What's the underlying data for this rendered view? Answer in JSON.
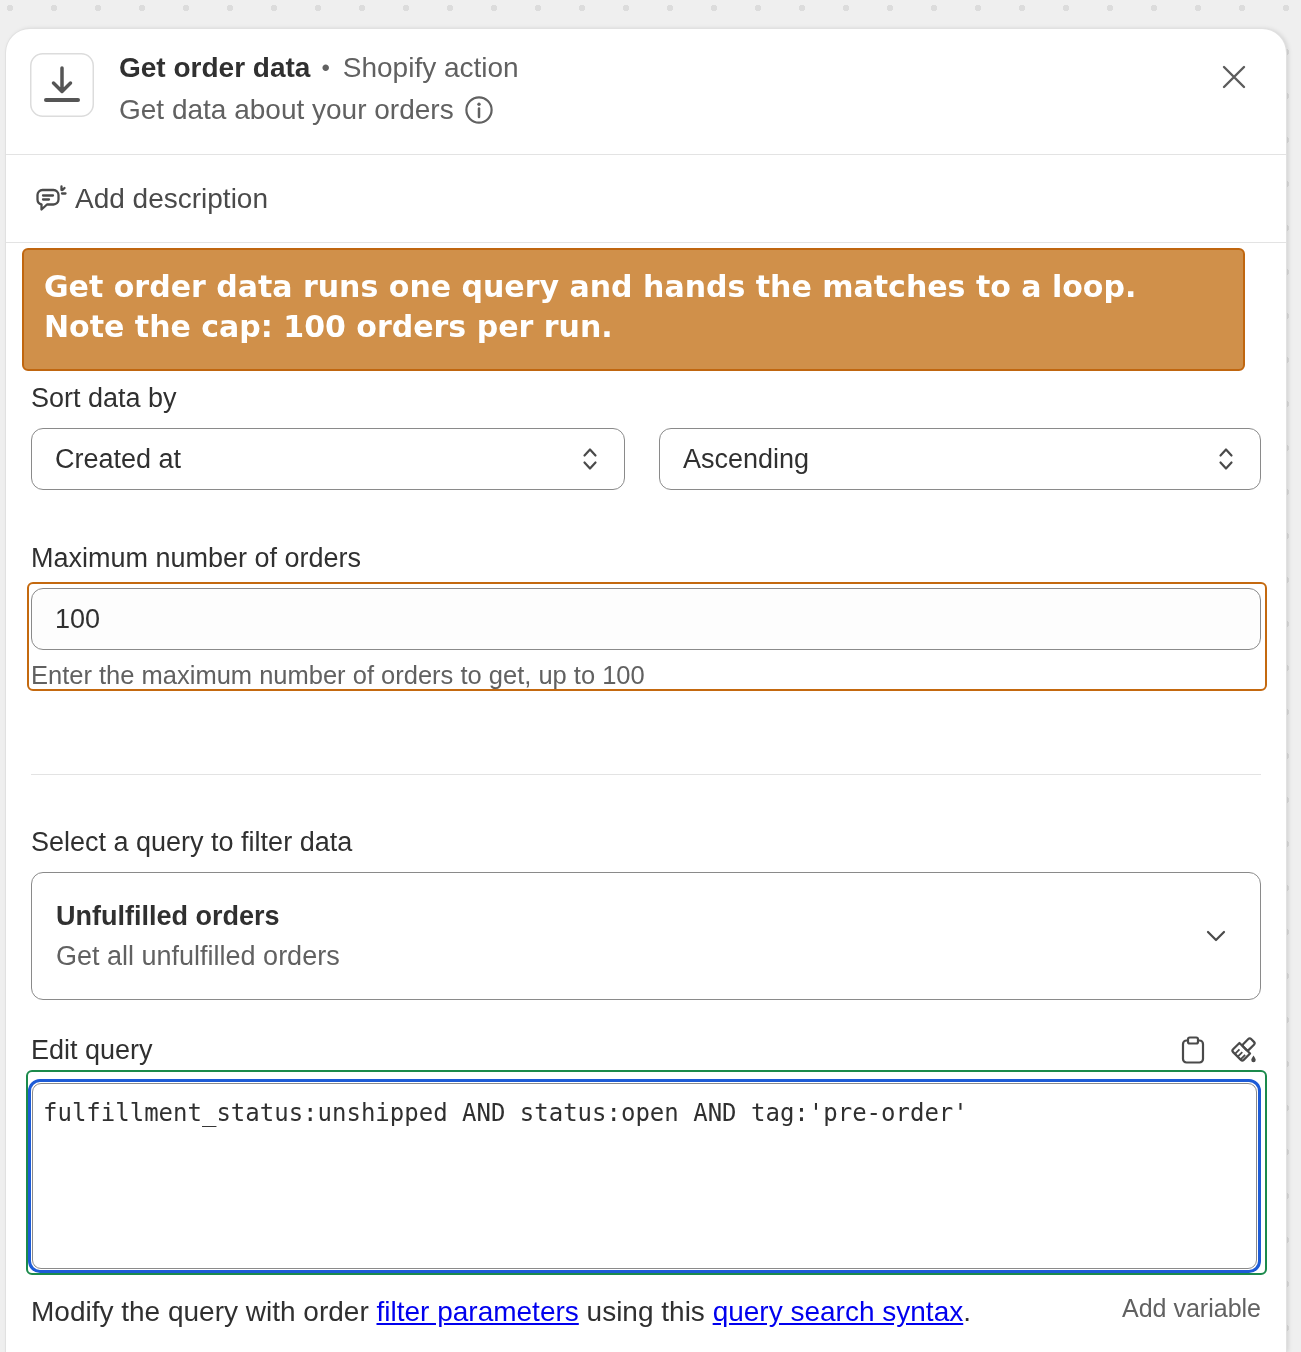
{
  "header": {
    "title": "Get order data",
    "separator": "•",
    "subtitle": "Shopify action",
    "description": "Get data about your orders"
  },
  "add_description": {
    "label": "Add description"
  },
  "callout": {
    "lines": [
      "Get order data runs one query and hands the matches to a loop.",
      "Note the cap: 100 orders per run."
    ]
  },
  "sort": {
    "label": "Sort data by",
    "selects": [
      {
        "value": "Created at"
      },
      {
        "value": "Ascending"
      }
    ]
  },
  "max_orders": {
    "label": "Maximum number of orders",
    "value": "100",
    "help": "Enter the maximum number of orders to get, up to 100",
    "highlighted": true
  },
  "query_select": {
    "label": "Select a query to filter data",
    "title": "Unfulfilled orders",
    "description": "Get all unfulfilled orders"
  },
  "edit_query": {
    "label": "Edit query",
    "value": "fulfillment_status:unshipped AND status:open AND tag:'pre-order'",
    "focused": true,
    "highlighted": true,
    "help": [
      {
        "kind": "text",
        "text": "Modify the query with order "
      },
      {
        "kind": "link",
        "text": "filter parameters"
      },
      {
        "kind": "text",
        "text": " using this "
      },
      {
        "kind": "link",
        "text": "query search syntax"
      },
      {
        "kind": "text",
        "text": "."
      }
    ],
    "add_variable": "Add variable"
  }
}
